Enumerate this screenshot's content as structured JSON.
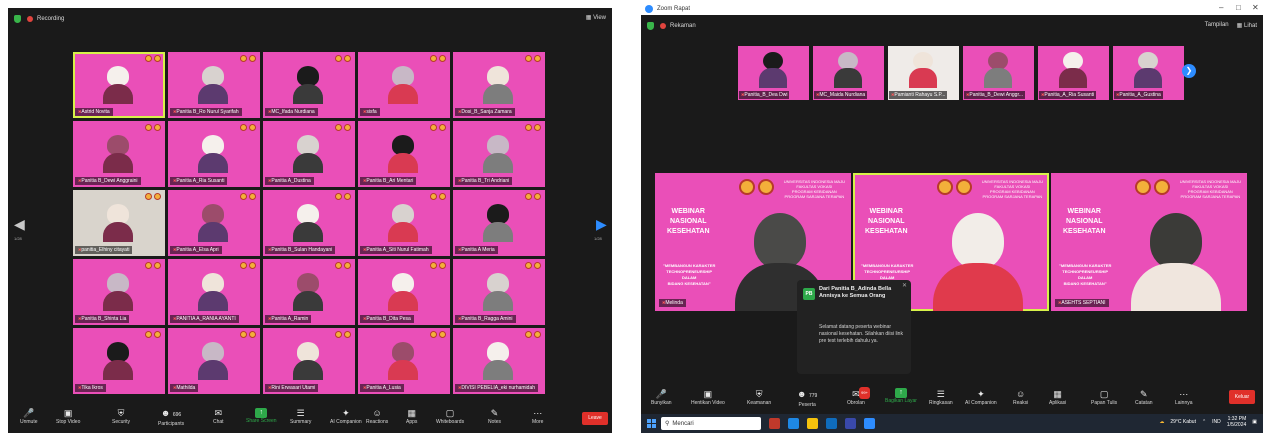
{
  "left": {
    "recording_label": "Recording",
    "view_label": "View",
    "page_left": "1/28",
    "page_right": "1/28",
    "participants": [
      "Astrid Novita",
      "Panitia B_Ro Nurul Syarifah",
      "MC_Ifada Nurdiana",
      "sisfa",
      "Dosi_B_Sanja Zamara",
      "Panitia B_Dewi Anggraini",
      "Panitia A_Ria Susanti",
      "Panitia A_Dustina",
      "Panitia B_Ari Mentari",
      "Panitia B_Tri Andriani",
      "panitia_Elhiny citayati",
      "Panitia A_Elsa Apri",
      "Panitia B_Sulan Handayani",
      "Panitia A_Siti Nurul Fatimah",
      "Panitia A Meria",
      "Panitia B_Shinta Lia",
      "PANITIA A_RANIA AYANTI",
      "Panitia A_Ramin",
      "Panitia B_Dita Pesa",
      "Panitia B_Ragga Amini",
      "Tika Ikros",
      "Mathilda",
      "Rini Erwasari Utami",
      "Panitia A_Lusia",
      "DIVISI PEBELIA_eki nurhamidah"
    ],
    "room_tile_index": 10,
    "toolbar": [
      {
        "icon": "mic-icon",
        "label": "Unmute"
      },
      {
        "icon": "video-icon",
        "label": "Stop Video"
      },
      {
        "icon": "security-icon",
        "label": "Security"
      },
      {
        "icon": "participants-icon",
        "label": "Participants",
        "count": "696"
      },
      {
        "icon": "chat-icon",
        "label": "Chat"
      },
      {
        "icon": "share-icon",
        "label": "Share Screen"
      },
      {
        "icon": "summary-icon",
        "label": "Summary"
      },
      {
        "icon": "ai-icon",
        "label": "AI Companion"
      },
      {
        "icon": "reactions-icon",
        "label": "Reactions"
      },
      {
        "icon": "apps-icon",
        "label": "Apps"
      },
      {
        "icon": "whiteboard-icon",
        "label": "Whiteboards"
      },
      {
        "icon": "notes-icon",
        "label": "Notes"
      },
      {
        "icon": "more-icon",
        "label": "More"
      }
    ],
    "leave_label": "Leave"
  },
  "right": {
    "window_title": "Zoom Rapat",
    "recording_label": "Rekaman",
    "top_view": "Tampilan",
    "top_layout": "Lihat",
    "strip": [
      "Panitia_B_Dea Dwi",
      "MC_Maida Nurdiana",
      "Pamianti Rahayu S.P...",
      "Panitia_B_Dewi Anggr...",
      "Panitia_A_Ria Susanti",
      "Panitia_A_Gustina"
    ],
    "speakers": [
      {
        "name": "Melinda"
      },
      {
        "name": "Adinda"
      },
      {
        "name": "ASEHTS SEPTIANI"
      }
    ],
    "banner": {
      "title": "WEBINAR\nNASIONAL\nKESEHATAN",
      "subtitle": "\"MEMBANGUN KARAKTER\nTECHNOPRENEURSHIP\nDALAM\nBIDANG KESEHATAN\"",
      "university": "UNIVERSITAS INDONESIA MAJU\nFAKULTAS VOKASI\nPROGRAM KEBIDANAN\nPROGRAM SARJANA TERAPAN"
    },
    "chat": {
      "avatar": "PB",
      "from": "Dari Panitia B_Adinda Bella Annisya ke Semua Orang",
      "message": "Selamat datang peserta webinar nasional kesehatan. Silahkan diisi link pre test terlebih dahulu ya."
    },
    "toolbar": [
      {
        "icon": "mic-icon",
        "label": "Bunyikan"
      },
      {
        "icon": "video-icon",
        "label": "Hentikan Video"
      },
      {
        "icon": "security-icon",
        "label": "Keamanan"
      },
      {
        "icon": "participants-icon",
        "label": "Peserta",
        "count": "779"
      },
      {
        "icon": "chat-icon",
        "label": "Obrolan",
        "badge": "99+"
      },
      {
        "icon": "share-icon",
        "label": "Bagikan Layar"
      },
      {
        "icon": "summary-icon",
        "label": "Ringkasan"
      },
      {
        "icon": "ai-icon",
        "label": "AI Companion"
      },
      {
        "icon": "reactions-icon",
        "label": "Reaksi"
      },
      {
        "icon": "apps-icon",
        "label": "Aplikasi"
      },
      {
        "icon": "whiteboard-icon",
        "label": "Papan Tulis"
      },
      {
        "icon": "notes-icon",
        "label": "Catatan"
      },
      {
        "icon": "more-icon",
        "label": "Lainnya"
      }
    ],
    "leave_label": "Keluar",
    "taskbar": {
      "search_placeholder": "Mencari",
      "weather": "29°C Kabut",
      "lang": "IND",
      "time": "1:32 PM",
      "date": "1/5/2024"
    }
  },
  "colors": {
    "banner_pink": "#ea4fb8",
    "active_speaker": "#d7f24a",
    "leave_red": "#e0302a",
    "share_green": "#2ea94a",
    "zoom_blue": "#2d8cff"
  }
}
